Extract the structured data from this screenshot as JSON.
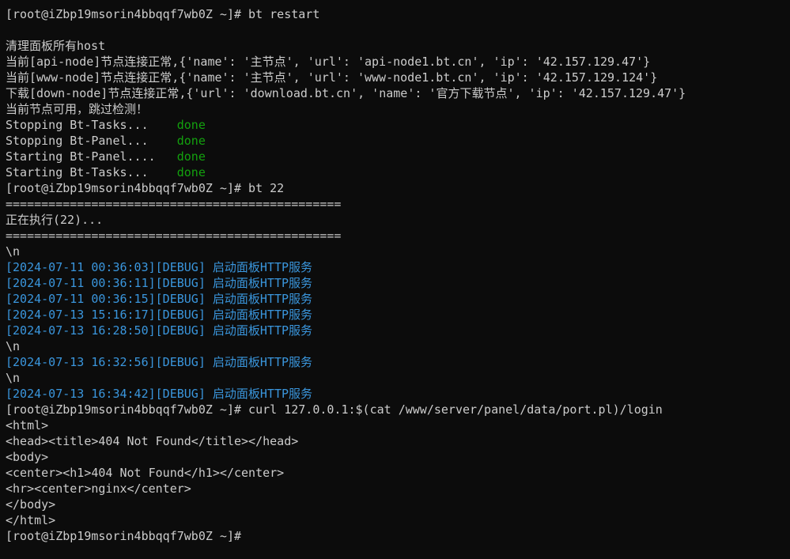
{
  "terminal": {
    "lines": [
      {
        "segments": [
          {
            "text": "[root@iZbp19msorin4bbqqf7wb0Z ~]# bt restart",
            "color": "#cccccc"
          }
        ]
      },
      {
        "segments": []
      },
      {
        "segments": [
          {
            "text": "清理面板所有host",
            "color": "#cccccc"
          }
        ]
      },
      {
        "segments": [
          {
            "text": "当前[api-node]节点连接正常,{'name': '主节点', 'url': 'api-node1.bt.cn', 'ip': '42.157.129.47'}",
            "color": "#cccccc"
          }
        ]
      },
      {
        "segments": [
          {
            "text": "当前[www-node]节点连接正常,{'name': '主节点', 'url': 'www-node1.bt.cn', 'ip': '42.157.129.124'}",
            "color": "#cccccc"
          }
        ]
      },
      {
        "segments": [
          {
            "text": "下载[down-node]节点连接正常,{'url': 'download.bt.cn', 'name': '官方下载节点', 'ip': '42.157.129.47'}",
            "color": "#cccccc"
          }
        ]
      },
      {
        "segments": [
          {
            "text": "当前节点可用，跳过检测！",
            "color": "#cccccc"
          }
        ]
      },
      {
        "segments": [
          {
            "text": "Stopping Bt-Tasks...    ",
            "color": "#cccccc"
          },
          {
            "text": "done",
            "color": "#13a10e"
          }
        ]
      },
      {
        "segments": [
          {
            "text": "Stopping Bt-Panel...    ",
            "color": "#cccccc"
          },
          {
            "text": "done",
            "color": "#13a10e"
          }
        ]
      },
      {
        "segments": [
          {
            "text": "Starting Bt-Panel....   ",
            "color": "#cccccc"
          },
          {
            "text": "done",
            "color": "#13a10e"
          }
        ]
      },
      {
        "segments": [
          {
            "text": "Starting Bt-Tasks...    ",
            "color": "#cccccc"
          },
          {
            "text": "done",
            "color": "#13a10e"
          }
        ]
      },
      {
        "segments": [
          {
            "text": "[root@iZbp19msorin4bbqqf7wb0Z ~]# bt 22",
            "color": "#cccccc"
          }
        ]
      },
      {
        "segments": [
          {
            "text": "===============================================",
            "color": "#cccccc"
          }
        ]
      },
      {
        "segments": [
          {
            "text": "正在执行(22)...",
            "color": "#cccccc"
          }
        ]
      },
      {
        "segments": [
          {
            "text": "===============================================",
            "color": "#cccccc"
          }
        ]
      },
      {
        "segments": [
          {
            "text": "\\n",
            "color": "#cccccc"
          }
        ]
      },
      {
        "segments": [
          {
            "text": "[2024-07-11 00:36:03][DEBUG] 启动面板HTTP服务",
            "color": "#3a96dd"
          }
        ]
      },
      {
        "segments": [
          {
            "text": "[2024-07-11 00:36:11][DEBUG] 启动面板HTTP服务",
            "color": "#3a96dd"
          }
        ]
      },
      {
        "segments": [
          {
            "text": "[2024-07-11 00:36:15][DEBUG] 启动面板HTTP服务",
            "color": "#3a96dd"
          }
        ]
      },
      {
        "segments": [
          {
            "text": "[2024-07-13 15:16:17][DEBUG] 启动面板HTTP服务",
            "color": "#3a96dd"
          }
        ]
      },
      {
        "segments": [
          {
            "text": "[2024-07-13 16:28:50][DEBUG] 启动面板HTTP服务",
            "color": "#3a96dd"
          }
        ]
      },
      {
        "segments": [
          {
            "text": "\\n",
            "color": "#cccccc"
          }
        ]
      },
      {
        "segments": [
          {
            "text": "[2024-07-13 16:32:56][DEBUG] 启动面板HTTP服务",
            "color": "#3a96dd"
          }
        ]
      },
      {
        "segments": [
          {
            "text": "\\n",
            "color": "#cccccc"
          }
        ]
      },
      {
        "segments": [
          {
            "text": "[2024-07-13 16:34:42][DEBUG] 启动面板HTTP服务",
            "color": "#3a96dd"
          }
        ]
      },
      {
        "segments": [
          {
            "text": "[root@iZbp19msorin4bbqqf7wb0Z ~]# curl 127.0.0.1:$(cat /www/server/panel/data/port.pl)/login",
            "color": "#cccccc"
          }
        ]
      },
      {
        "segments": [
          {
            "text": "<html>",
            "color": "#cccccc"
          }
        ]
      },
      {
        "segments": [
          {
            "text": "<head><title>404 Not Found</title></head>",
            "color": "#cccccc"
          }
        ]
      },
      {
        "segments": [
          {
            "text": "<body>",
            "color": "#cccccc"
          }
        ]
      },
      {
        "segments": [
          {
            "text": "<center><h1>404 Not Found</h1></center>",
            "color": "#cccccc"
          }
        ]
      },
      {
        "segments": [
          {
            "text": "<hr><center>nginx</center>",
            "color": "#cccccc"
          }
        ]
      },
      {
        "segments": [
          {
            "text": "</body>",
            "color": "#cccccc"
          }
        ]
      },
      {
        "segments": [
          {
            "text": "</html>",
            "color": "#cccccc"
          }
        ]
      },
      {
        "segments": [
          {
            "text": "[root@iZbp19msorin4bbqqf7wb0Z ~]#",
            "color": "#cccccc"
          }
        ]
      }
    ]
  }
}
